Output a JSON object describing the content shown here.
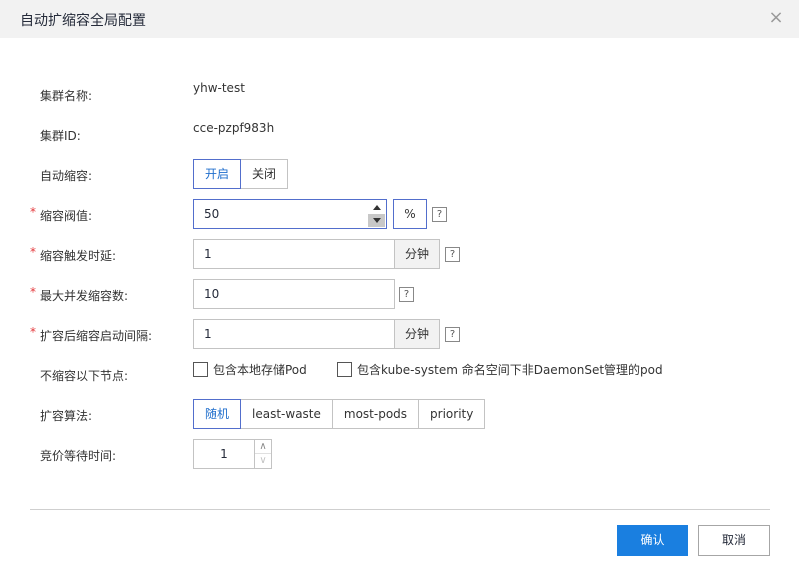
{
  "dialog": {
    "title": "自动扩缩容全局配置",
    "close_label": "×"
  },
  "fields": {
    "cluster_name": {
      "label": "集群名称:",
      "value": "yhw-test"
    },
    "cluster_id": {
      "label": "集群ID:",
      "value": "cce-pzpf983h"
    },
    "auto_scale_down": {
      "label": "自动缩容:",
      "options": [
        "开启",
        "关闭"
      ],
      "selected": "开启"
    },
    "scale_down_threshold": {
      "required_mark": "*",
      "label": "缩容阀值:",
      "value": "50",
      "unit": "%",
      "help": "?"
    },
    "scale_down_trigger_delay": {
      "required_mark": "*",
      "label": "缩容触发时延:",
      "value": "1",
      "unit": "分钟",
      "help": "?"
    },
    "max_concurrent_scale_down": {
      "required_mark": "*",
      "label": "最大并发缩容数:",
      "value": "10",
      "help": "?"
    },
    "scale_down_interval_after_scale_up": {
      "required_mark": "*",
      "label": "扩容后缩容启动间隔:",
      "value": "1",
      "unit": "分钟",
      "help": "?"
    },
    "no_scale_down_nodes": {
      "label": "不缩容以下节点:",
      "options": [
        {
          "label": "包含本地存储Pod",
          "checked": false
        },
        {
          "label": "包含kube-system 命名空间下非DaemonSet管理的pod",
          "checked": false
        }
      ]
    },
    "expander": {
      "label": "扩容算法:",
      "options": [
        "随机",
        "least-waste",
        "most-pods",
        "priority"
      ],
      "selected": "随机"
    },
    "spot_wait_time": {
      "label": "竞价等待时间:",
      "value": "1",
      "up_icon": "∧",
      "down_icon": "∨"
    }
  },
  "footer": {
    "confirm_label": "确认",
    "cancel_label": "取消"
  },
  "colors": {
    "primary": "#1a7fe0",
    "active_border": "#526ecc",
    "required": "#e4393c",
    "header_bg": "#f2f2f2"
  }
}
